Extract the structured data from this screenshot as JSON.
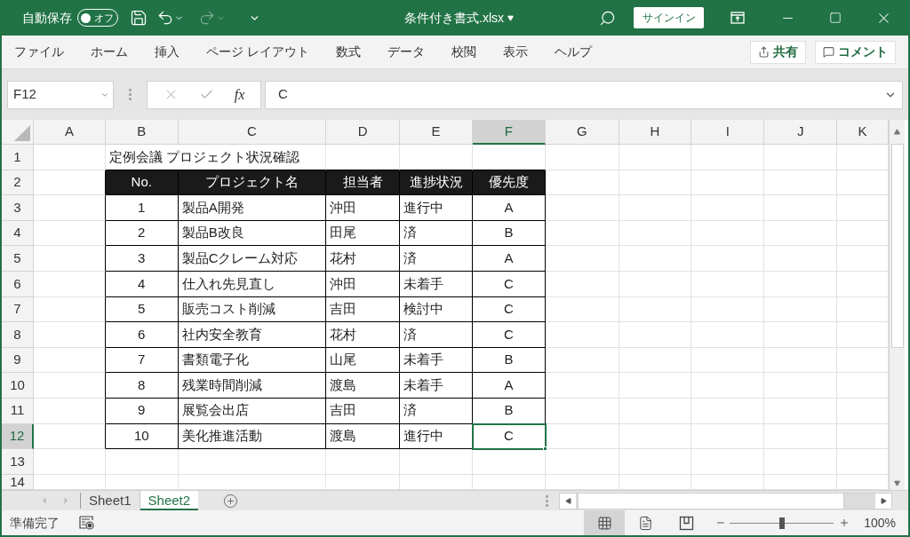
{
  "title_bar": {
    "autosave": {
      "label": "自動保存",
      "toggle_text": "オフ",
      "on": false
    },
    "file_title": "条件付き書式.xlsx",
    "sign_in": "サインイン"
  },
  "ribbon_tabs": [
    "ファイル",
    "ホーム",
    "挿入",
    "ページ レイアウト",
    "数式",
    "データ",
    "校閲",
    "表示",
    "ヘルプ"
  ],
  "ribbon_actions": {
    "share": "共有",
    "comment": "コメント"
  },
  "formula_bar": {
    "name_box": "F12",
    "fx": "fx",
    "value": "C"
  },
  "sheet": {
    "columns": [
      {
        "label": "A",
        "selected": false
      },
      {
        "label": "B",
        "selected": false
      },
      {
        "label": "C",
        "selected": false
      },
      {
        "label": "D",
        "selected": false
      },
      {
        "label": "E",
        "selected": false
      },
      {
        "label": "F",
        "selected": true
      },
      {
        "label": "G",
        "selected": false
      },
      {
        "label": "H",
        "selected": false
      },
      {
        "label": "I",
        "selected": false
      },
      {
        "label": "J",
        "selected": false
      },
      {
        "label": "K",
        "selected": false
      }
    ],
    "rows": [
      {
        "label": "1",
        "selected": false
      },
      {
        "label": "2",
        "selected": false
      },
      {
        "label": "3",
        "selected": false
      },
      {
        "label": "4",
        "selected": false
      },
      {
        "label": "5",
        "selected": false
      },
      {
        "label": "6",
        "selected": false
      },
      {
        "label": "7",
        "selected": false
      },
      {
        "label": "8",
        "selected": false
      },
      {
        "label": "9",
        "selected": false
      },
      {
        "label": "10",
        "selected": false
      },
      {
        "label": "11",
        "selected": false
      },
      {
        "label": "12",
        "selected": true
      },
      {
        "label": "13",
        "selected": false
      },
      {
        "label": "14",
        "selected": false
      }
    ],
    "title_cell": "定例会議 プロジェクト状況確認",
    "table": {
      "header": [
        "No.",
        "プロジェクト名",
        "担当者",
        "進捗状況",
        "優先度"
      ],
      "rows": [
        {
          "cells": [
            {
              "text": "1",
              "selected": false
            },
            {
              "text": "製品A開発",
              "selected": false
            },
            {
              "text": "沖田",
              "selected": false
            },
            {
              "text": "進行中",
              "selected": false
            },
            {
              "text": "A",
              "selected": false
            }
          ]
        },
        {
          "cells": [
            {
              "text": "2",
              "selected": false
            },
            {
              "text": "製品B改良",
              "selected": false
            },
            {
              "text": "田尾",
              "selected": false
            },
            {
              "text": "済",
              "selected": false
            },
            {
              "text": "B",
              "selected": false
            }
          ]
        },
        {
          "cells": [
            {
              "text": "3",
              "selected": false
            },
            {
              "text": "製品Cクレーム対応",
              "selected": false
            },
            {
              "text": "花村",
              "selected": false
            },
            {
              "text": "済",
              "selected": false
            },
            {
              "text": "A",
              "selected": false
            }
          ]
        },
        {
          "cells": [
            {
              "text": "4",
              "selected": false
            },
            {
              "text": "仕入れ先見直し",
              "selected": false
            },
            {
              "text": "沖田",
              "selected": false
            },
            {
              "text": "未着手",
              "selected": false
            },
            {
              "text": "C",
              "selected": false
            }
          ]
        },
        {
          "cells": [
            {
              "text": "5",
              "selected": false
            },
            {
              "text": "販売コスト削減",
              "selected": false
            },
            {
              "text": "吉田",
              "selected": false
            },
            {
              "text": "検討中",
              "selected": false
            },
            {
              "text": "C",
              "selected": false
            }
          ]
        },
        {
          "cells": [
            {
              "text": "6",
              "selected": false
            },
            {
              "text": "社内安全教育",
              "selected": false
            },
            {
              "text": "花村",
              "selected": false
            },
            {
              "text": "済",
              "selected": false
            },
            {
              "text": "C",
              "selected": false
            }
          ]
        },
        {
          "cells": [
            {
              "text": "7",
              "selected": false
            },
            {
              "text": "書類電子化",
              "selected": false
            },
            {
              "text": "山尾",
              "selected": false
            },
            {
              "text": "未着手",
              "selected": false
            },
            {
              "text": "B",
              "selected": false
            }
          ]
        },
        {
          "cells": [
            {
              "text": "8",
              "selected": false
            },
            {
              "text": "残業時間削減",
              "selected": false
            },
            {
              "text": "渡島",
              "selected": false
            },
            {
              "text": "未着手",
              "selected": false
            },
            {
              "text": "A",
              "selected": false
            }
          ]
        },
        {
          "cells": [
            {
              "text": "9",
              "selected": false
            },
            {
              "text": "展覧会出店",
              "selected": false
            },
            {
              "text": "吉田",
              "selected": false
            },
            {
              "text": "済",
              "selected": false
            },
            {
              "text": "B",
              "selected": false
            }
          ]
        },
        {
          "cells": [
            {
              "text": "10",
              "selected": false
            },
            {
              "text": "美化推進活動",
              "selected": false
            },
            {
              "text": "渡島",
              "selected": false
            },
            {
              "text": "進行中",
              "selected": false
            },
            {
              "text": "C",
              "selected": true
            }
          ]
        }
      ]
    }
  },
  "sheet_tabs": [
    {
      "label": "Sheet1",
      "selected": false
    },
    {
      "label": "Sheet2",
      "selected": true
    }
  ],
  "status_bar": {
    "status": "準備完了",
    "views": [
      {
        "kind": "normal",
        "selected": true
      },
      {
        "kind": "page-layout",
        "selected": false
      },
      {
        "kind": "page-break",
        "selected": false
      }
    ],
    "zoom": {
      "level": 0.5,
      "text": "100%"
    }
  }
}
